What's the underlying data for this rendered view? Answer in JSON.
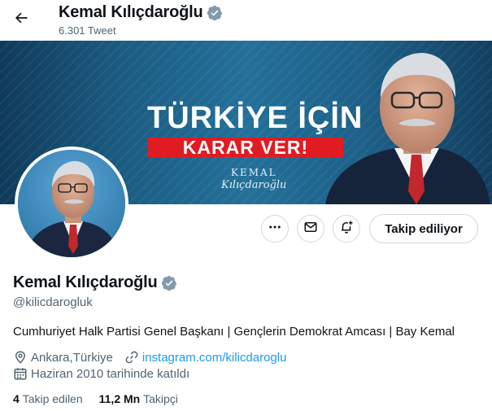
{
  "header": {
    "name": "Kemal Kılıçdaroğlu",
    "tweet_count": "6.301 Tweet",
    "back_icon": "arrow-left-icon"
  },
  "banner": {
    "title": "TÜRKİYE İÇİN",
    "subtitle": "KARAR VER!",
    "signature_top": "KEMAL",
    "signature_bottom": "Kılıçdaroğlu",
    "colors": {
      "background": "#1b5c82",
      "accent": "#e11b22"
    }
  },
  "actions": {
    "more_icon": "more-dots-icon",
    "message_icon": "envelope-icon",
    "notify_icon": "bell-plus-icon",
    "follow_label": "Takip ediliyor"
  },
  "profile": {
    "name": "Kemal Kılıçdaroğlu",
    "handle": "@kilicdarogluk",
    "bio": "Cumhuriyet Halk Partisi Genel Başkanı | Gençlerin Demokrat Amcası | Bay Kemal",
    "location": "Ankara,Türkiye",
    "website": "instagram.com/kilicdaroglu",
    "joined": "Haziran 2010 tarihinde katıldı",
    "verified_badge_color": "#829aab"
  },
  "stats": {
    "following_count": "4",
    "following_label": "Takip edilen",
    "followers_count": "11,2 Mn",
    "followers_label": "Takipçi"
  }
}
